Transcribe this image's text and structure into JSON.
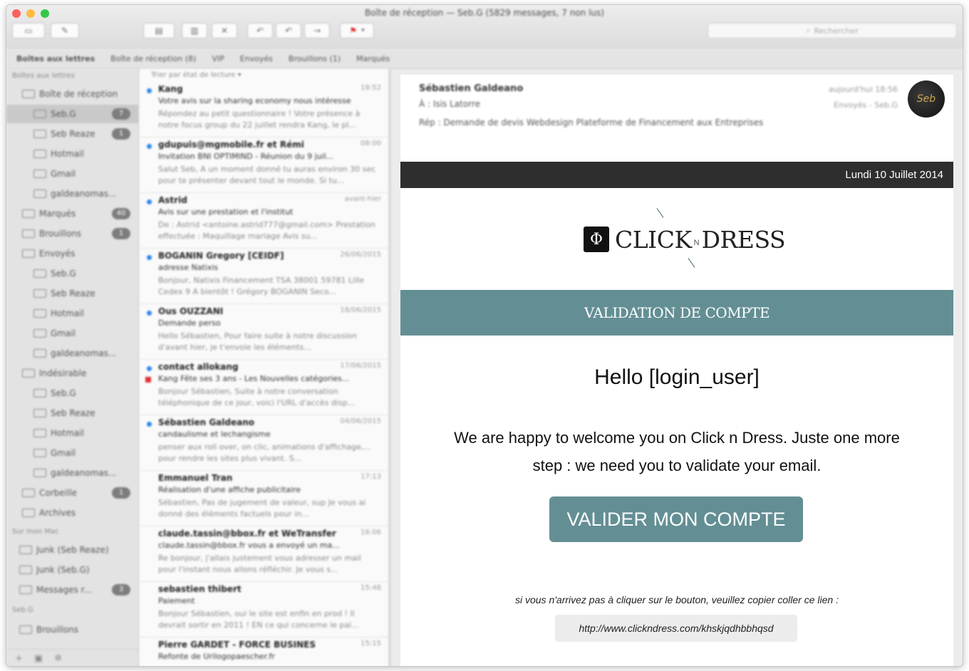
{
  "window": {
    "title": "Boîte de réception — Seb.G (5829 messages, 7 non lus)",
    "search_placeholder": "Rechercher"
  },
  "favorites": [
    "Boîtes aux lettres",
    "Boîte de réception (8)",
    "VIP",
    "Envoyés",
    "Brouillons (1)",
    "Marqués"
  ],
  "sidebar": {
    "section_mailboxes": "Boîtes aux lettres",
    "items": [
      {
        "label": "Boîte de réception",
        "badge": ""
      },
      {
        "label": "Seb.G",
        "badge": "7"
      },
      {
        "label": "Seb Reaze",
        "badge": "1"
      },
      {
        "label": "Hotmail",
        "badge": ""
      },
      {
        "label": "Gmail",
        "badge": ""
      },
      {
        "label": "galdeanomas...",
        "badge": ""
      },
      {
        "label": "Marqués",
        "badge": "40"
      },
      {
        "label": "Brouillons",
        "badge": "1"
      },
      {
        "label": "Envoyés",
        "badge": ""
      },
      {
        "label": "Seb.G",
        "badge": ""
      },
      {
        "label": "Seb Reaze",
        "badge": ""
      },
      {
        "label": "Hotmail",
        "badge": ""
      },
      {
        "label": "Gmail",
        "badge": ""
      },
      {
        "label": "galdeanomas...",
        "badge": ""
      },
      {
        "label": "Indésirable",
        "badge": ""
      },
      {
        "label": "Seb.G",
        "badge": ""
      },
      {
        "label": "Seb Reaze",
        "badge": ""
      },
      {
        "label": "Hotmail",
        "badge": ""
      },
      {
        "label": "Gmail",
        "badge": ""
      },
      {
        "label": "galdeanomas...",
        "badge": ""
      },
      {
        "label": "Corbeille",
        "badge": "1"
      },
      {
        "label": "Archives",
        "badge": ""
      }
    ],
    "section_mac": "Sur mon Mac",
    "mac_items": [
      {
        "label": "Junk (Seb Reaze)",
        "badge": ""
      },
      {
        "label": "Junk (Seb.G)",
        "badge": ""
      },
      {
        "label": "Messages r...",
        "badge": "3"
      }
    ],
    "section_sebg": "Seb.G",
    "sebg_items": [
      {
        "label": "Brouillons",
        "badge": ""
      }
    ]
  },
  "message_list": {
    "sort_label": "Trier par état de lecture",
    "messages": [
      {
        "sender": "Kang",
        "date": "18:52",
        "subject": "Votre avis sur la sharing economy nous intéresse",
        "preview": "Répondez au petit questionnaire ! Votre présence à notre focus group du 22 juillet rendra Kang, le pl..."
      },
      {
        "sender": "gdupuis@mgmobile.fr et Rémi",
        "date": "08:00",
        "subject": "Invitation BNI OPTIMIND - Réunion du 9 juil...",
        "preview": "Salut Seb, A un moment donné tu auras environ 30 sec pour te présenter devant tout le monde. Si tu..."
      },
      {
        "sender": "Astrid",
        "date": "avant-hier",
        "subject": "Avis sur une prestation et l'institut",
        "preview": "De : Astrid <antoine.astrid777@gmail.com> Prestation effectuée : Maquillage mariage Avis su..."
      },
      {
        "sender": "BOGANIN Gregory [CEIDF]",
        "date": "26/06/2015",
        "subject": "adresse Natixis",
        "preview": "Bonjour, Natixis Financement TSA 38001 59781 Lille Cedex 9 A bientôt ! Grégory BOGANIN Seco..."
      },
      {
        "sender": "Ous OUZZANI",
        "date": "18/06/2015",
        "subject": "Demande perso",
        "preview": "Hello Sébastien, Pour faire suite à notre discussion d'avant hier, je t'envoie les éléments..."
      },
      {
        "sender": "contact allokang",
        "date": "17/06/2015",
        "subject": "Kang Fête ses 3 ans - Les Nouvelles catégories...",
        "preview": "Bonjour Sébastien, Suite à notre conversation téléphonique de ce jour, voici l'URL d'accès disp..."
      },
      {
        "sender": "Sébastien Galdeano",
        "date": "04/06/2015",
        "subject": "candaulisme et lechangisme",
        "preview": "penser aux roll over, on clic, animations d'affichage,... pour rendre les sites plus vivant. S..."
      },
      {
        "sender": "Emmanuel Tran",
        "date": "17:13",
        "subject": "Réalisation d'une affiche publicitaire",
        "preview": "Sébastien, Pas de jugement de valeur, sup Je vous ai donné des éléments factuels pour in..."
      },
      {
        "sender": "claude.tassin@bbox.fr et WeTransfer",
        "date": "16:06",
        "subject": "claude.tassin@bbox.fr vous a envoyé un ma...",
        "preview": "Re bonjour, j'allais justement vous adresser un mail pour l'instant nous allons réfléchir. Je vous s..."
      },
      {
        "sender": "sebastien thibert",
        "date": "15:48",
        "subject": "Paiement",
        "preview": "Bonjour Sébastien, oui le site est enfin en prod ! Il devrait sortir en 2011 ! EN ce qui concerne le pai..."
      },
      {
        "sender": "Pierre GARDET - FORCE BUSINES",
        "date": "15:15",
        "subject": "Refonte de Urilogopaescher.fr",
        "preview": ""
      }
    ]
  },
  "reading_pane": {
    "sender": "Sébastien Galdeano",
    "to_label": "À :",
    "to": "Isis Latorre",
    "subject": "Rép : Demande de devis Webdesign Plateforme de Financement aux Entreprises",
    "date": "aujourd'hui 18:56",
    "sent_from": "Envoyés - Seb.G",
    "avatar_text": "Seb"
  },
  "email": {
    "date_banner": "Lundi 10 Juillet 2014",
    "logo_mark": "Φ",
    "logo_word1": "CLICK",
    "logo_n": "N",
    "logo_word2": "DRESS",
    "validation_heading": "VALIDATION DE COMPTE",
    "greeting": "Hello [login_user]",
    "welcome_text": "We are happy to welcome you on Click n Dress. Juste one more step : we need you to validate your email.",
    "cta_label": "VALIDER MON COMPTE",
    "fallback_text": "si vous n'arrivez pas à cliquer sur le bouton, veuillez copier coller ce lien :",
    "fallback_link": "http://www.clickndress.com/khskjqdhbbhqsd"
  },
  "colors": {
    "accent_teal": "#638f94",
    "date_banner_bg": "#2e2e2e",
    "unread_dot": "#2a86f0",
    "flag_red": "#e03030"
  }
}
